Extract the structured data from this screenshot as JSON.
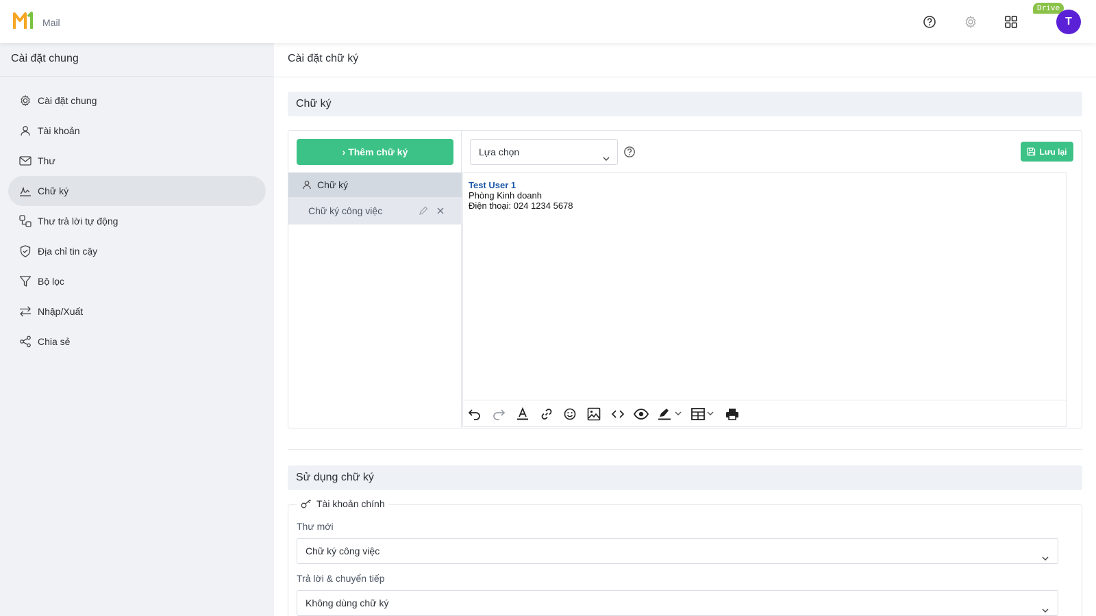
{
  "app": {
    "name": "Mail",
    "drive_badge": "Drive",
    "avatar_initial": "T"
  },
  "colors": {
    "accent_green": "#3cc286",
    "avatar": "#5b21d6",
    "logo_orange": "#f5a623",
    "logo_green": "#7cc242",
    "link_blue": "#1a56a6"
  },
  "sidebar": {
    "title": "Cài đặt chung",
    "items": [
      {
        "label": "Cài đặt chung",
        "icon": "gear-icon"
      },
      {
        "label": "Tài khoản",
        "icon": "user-icon"
      },
      {
        "label": "Thư",
        "icon": "mail-icon"
      },
      {
        "label": "Chữ ký",
        "icon": "signature-icon",
        "active": true
      },
      {
        "label": "Thư trả lời tự động",
        "icon": "auto-reply-icon"
      },
      {
        "label": "Địa chỉ tin cậy",
        "icon": "shield-icon"
      },
      {
        "label": "Bộ lọc",
        "icon": "filter-icon"
      },
      {
        "label": "Nhập/Xuất",
        "icon": "import-export-icon"
      },
      {
        "label": "Chia sẻ",
        "icon": "share-icon"
      }
    ]
  },
  "main": {
    "title": "Cài đặt chữ ký",
    "signature_section": {
      "title": "Chữ ký",
      "add_button": "› Thêm chữ ký",
      "group_label": "Chữ ký",
      "signatures": [
        {
          "name": "Chữ ký công việc"
        }
      ],
      "select_value": "Lựa chọn",
      "save_button": "Lưu lại",
      "editor": {
        "name": "Test User 1",
        "line2": "Phòng Kinh doanh",
        "line3": "Điện thoại: 024 1234 5678"
      }
    },
    "usage_section": {
      "title": "Sử dụng chữ ký",
      "account_legend": "Tài khoản chính",
      "new_mail_label": "Thư mới",
      "new_mail_value": "Chữ ký công việc",
      "reply_label": "Trả lời & chuyển tiếp",
      "reply_value": "Không dùng chữ ký"
    }
  }
}
